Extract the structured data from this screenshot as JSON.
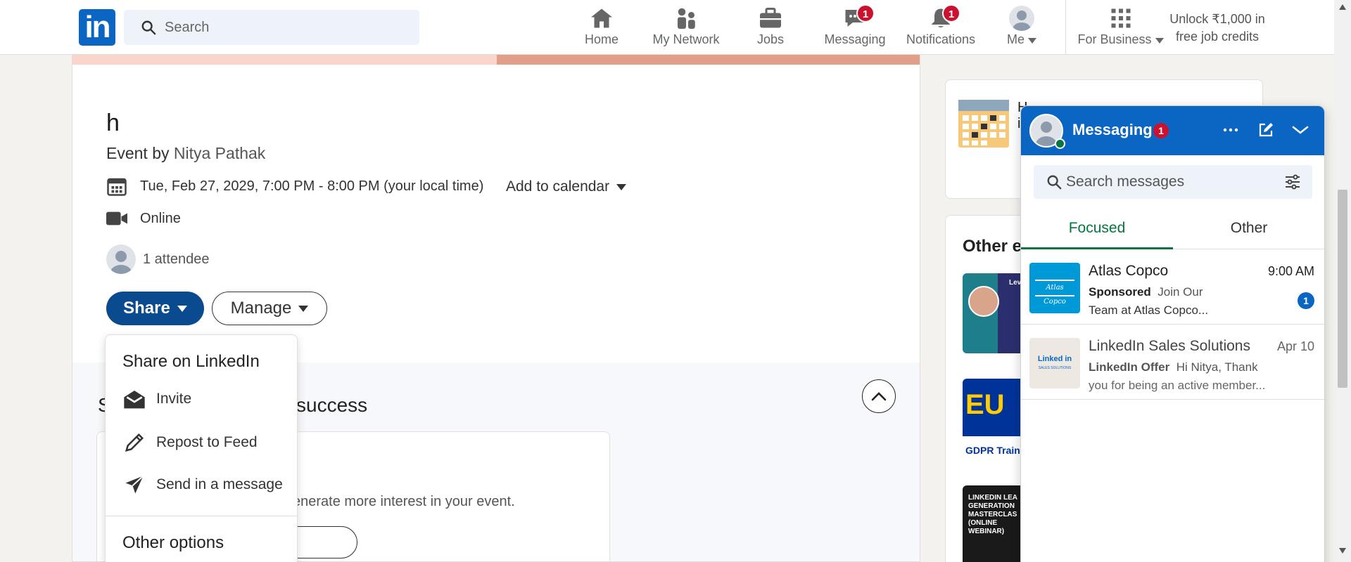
{
  "header": {
    "search_placeholder": "Search",
    "nav": [
      {
        "label": "Home",
        "icon": "home-icon"
      },
      {
        "label": "My Network",
        "icon": "network-icon"
      },
      {
        "label": "Jobs",
        "icon": "briefcase-icon"
      },
      {
        "label": "Messaging",
        "icon": "messaging-icon",
        "badge": "1"
      },
      {
        "label": "Notifications",
        "icon": "bell-icon",
        "badge": "1"
      },
      {
        "label": "Me",
        "icon": "avatar"
      },
      {
        "label": "For Business",
        "icon": "grid-icon"
      }
    ],
    "unlock_line1": "Unlock ₹1,000 in",
    "unlock_line2": "free job credits"
  },
  "event": {
    "title": "h",
    "by_prefix": "Event by ",
    "host": "Nitya Pathak",
    "datetime": "Tue, Feb 27, 2029, 7:00 PM - 8:00 PM (your local time)",
    "add_to_calendar": "Add to calendar",
    "location": "Online",
    "attendees": "1 attendee",
    "share_label": "Share",
    "manage_label": "Manage"
  },
  "lower": {
    "title_start": "S",
    "title_end": "success",
    "tip_text": "enerate more interest in your event."
  },
  "share_menu": {
    "header": "Share on LinkedIn",
    "items": [
      {
        "label": "Invite",
        "icon": "envelope-open-icon"
      },
      {
        "label": "Repost to Feed",
        "icon": "pencil-icon"
      },
      {
        "label": "Send in a message",
        "icon": "send-icon"
      }
    ],
    "other": "Other options"
  },
  "rail": {
    "card1_text_a": "H",
    "card1_text_b": "i",
    "card2_title": "Other e",
    "thumb1_text": "Lev",
    "thumb2_text": "EU",
    "thumb2_caption": "GDPR Trainin",
    "thumb3_text": "LINKEDIN LEA GENERATION MASTERCLAS (ONLINE WEBINAR)"
  },
  "messaging": {
    "title": "Messaging",
    "badge": "1",
    "search_placeholder": "Search messages",
    "tabs": [
      "Focused",
      "Other"
    ],
    "conversations": [
      {
        "name": "Atlas Copco",
        "time": "9:00 AM",
        "tag": "Sponsored",
        "line1": "Join Our",
        "line2": "Team at Atlas Copco...",
        "unread": "1",
        "logo_text": "Atlas Copco"
      },
      {
        "name": "LinkedIn Sales Solutions",
        "time": "Apr 10",
        "tag": "LinkedIn Offer",
        "line1": "Hi Nitya, Thank",
        "line2": "you for being an active member...",
        "logo_text": "Linked in",
        "logo_sub": "SALES SOLUTIONS"
      }
    ]
  },
  "colors": {
    "brand": "#0a66c2",
    "badge": "#cb112d",
    "focused": "#057642",
    "share_button": "#0a4a8e"
  }
}
